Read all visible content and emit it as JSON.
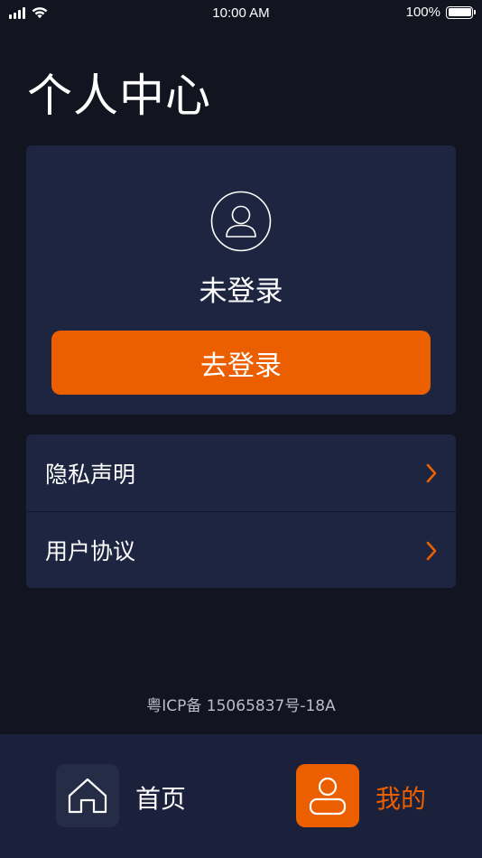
{
  "status_bar": {
    "time": "10:00 AM",
    "battery_percent": "100%",
    "battery_level": 1.0,
    "signal_icon": "cellular-signal-icon",
    "wifi_icon": "wifi-icon",
    "battery_icon": "battery-icon"
  },
  "page": {
    "title": "个人中心"
  },
  "profile": {
    "avatar_icon": "user-avatar-icon",
    "status_text": "未登录",
    "login_button_label": "去登录"
  },
  "menu": {
    "items": [
      {
        "label": "隐私声明",
        "icon": "chevron-right-icon"
      },
      {
        "label": "用户协议",
        "icon": "chevron-right-icon"
      }
    ]
  },
  "footer": {
    "icp": "粤ICP备 15065837号-18A"
  },
  "tab_bar": {
    "tabs": [
      {
        "label": "首页",
        "icon": "home-icon",
        "active": false
      },
      {
        "label": "我的",
        "icon": "user-icon",
        "active": true
      }
    ]
  },
  "colors": {
    "background": "#121420",
    "card": "#1d2540",
    "accent": "#eb5f00",
    "tab_bar": "#1b213a",
    "muted_text": "#b9bdc9"
  }
}
